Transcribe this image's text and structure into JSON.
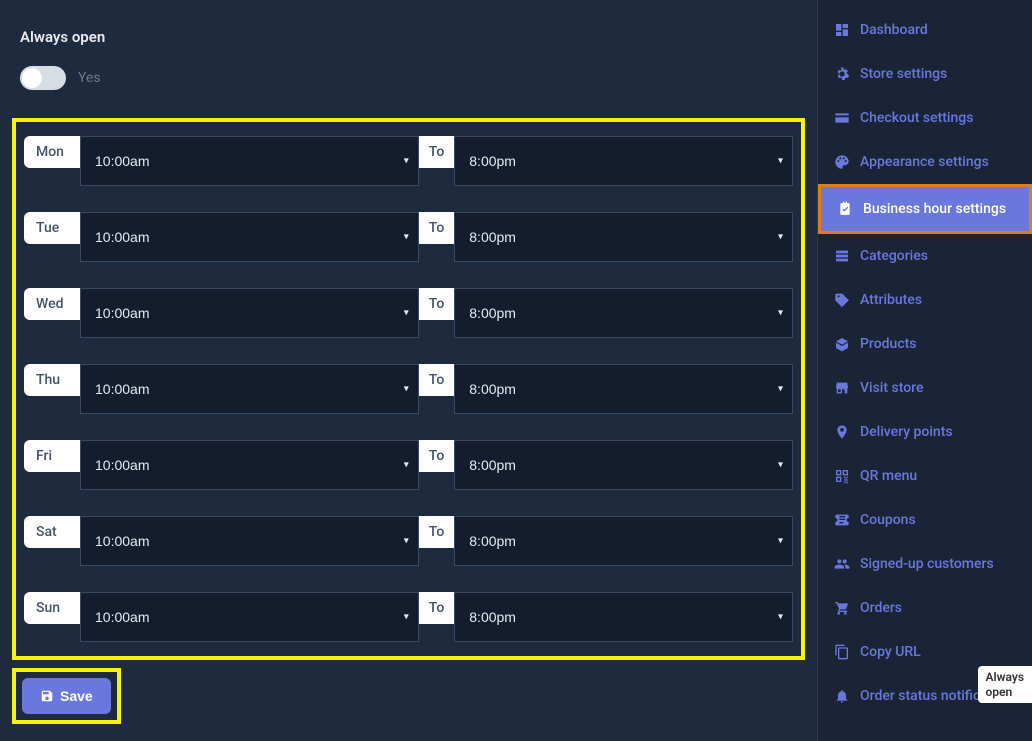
{
  "alwaysOpen": {
    "label": "Always open",
    "toggleText": "Yes"
  },
  "toLabel": "To",
  "days": [
    {
      "name": "Mon",
      "open": "10:00am",
      "close": "8:00pm"
    },
    {
      "name": "Tue",
      "open": "10:00am",
      "close": "8:00pm"
    },
    {
      "name": "Wed",
      "open": "10:00am",
      "close": "8:00pm"
    },
    {
      "name": "Thu",
      "open": "10:00am",
      "close": "8:00pm"
    },
    {
      "name": "Fri",
      "open": "10:00am",
      "close": "8:00pm"
    },
    {
      "name": "Sat",
      "open": "10:00am",
      "close": "8:00pm"
    },
    {
      "name": "Sun",
      "open": "10:00am",
      "close": "8:00pm"
    }
  ],
  "saveLabel": "Save",
  "sidebar": {
    "items": [
      {
        "icon": "dashboard-icon",
        "label": "Dashboard"
      },
      {
        "icon": "gear-icon",
        "label": "Store settings"
      },
      {
        "icon": "card-icon",
        "label": "Checkout settings"
      },
      {
        "icon": "palette-icon",
        "label": "Appearance settings"
      },
      {
        "icon": "clock-icon",
        "label": "Business hour settings",
        "active": true
      },
      {
        "icon": "categories-icon",
        "label": "Categories"
      },
      {
        "icon": "tags-icon",
        "label": "Attributes"
      },
      {
        "icon": "box-icon",
        "label": "Products"
      },
      {
        "icon": "store-icon",
        "label": "Visit store"
      },
      {
        "icon": "pin-icon",
        "label": "Delivery points"
      },
      {
        "icon": "qr-icon",
        "label": "QR menu"
      },
      {
        "icon": "coupon-icon",
        "label": "Coupons"
      },
      {
        "icon": "users-icon",
        "label": "Signed-up customers"
      },
      {
        "icon": "cart-icon",
        "label": "Orders"
      },
      {
        "icon": "copy-icon",
        "label": "Copy URL"
      },
      {
        "icon": "bell-icon",
        "label": "Order status notification"
      }
    ]
  },
  "badge": "Always\nopen"
}
